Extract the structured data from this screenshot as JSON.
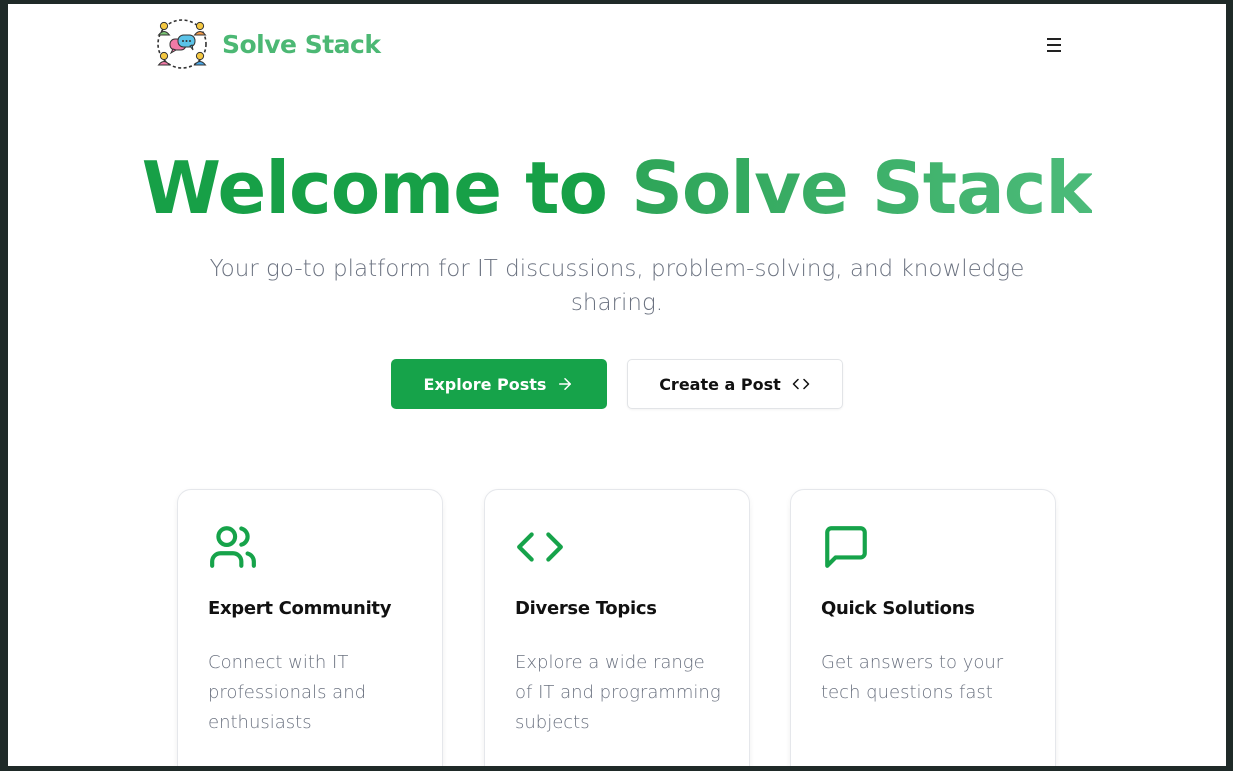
{
  "header": {
    "brand": "Solve Stack",
    "logo_icon": "community-chat-logo-icon",
    "menu_icon": "hamburger-menu-icon"
  },
  "hero": {
    "title_part1": "Welcome to ",
    "title_part2": "Solve Stack",
    "subtitle": "Your go-to platform for IT discussions, problem-solving, and knowledge sharing."
  },
  "actions": {
    "explore_label": "Explore Posts",
    "explore_icon": "arrow-right-icon",
    "create_label": "Create a Post",
    "create_icon": "code-brackets-icon"
  },
  "features": [
    {
      "icon": "users-icon",
      "title": "Expert Community",
      "description": "Connect with IT professionals and enthusiasts"
    },
    {
      "icon": "code-icon",
      "title": "Diverse Topics",
      "description": "Explore a wide range of IT and programming subjects"
    },
    {
      "icon": "message-square-icon",
      "title": "Quick Solutions",
      "description": "Get answers to your tech questions fast"
    }
  ],
  "colors": {
    "primary": "#16a34a",
    "brand_text": "#4cb874",
    "muted_text": "#6b7280"
  }
}
